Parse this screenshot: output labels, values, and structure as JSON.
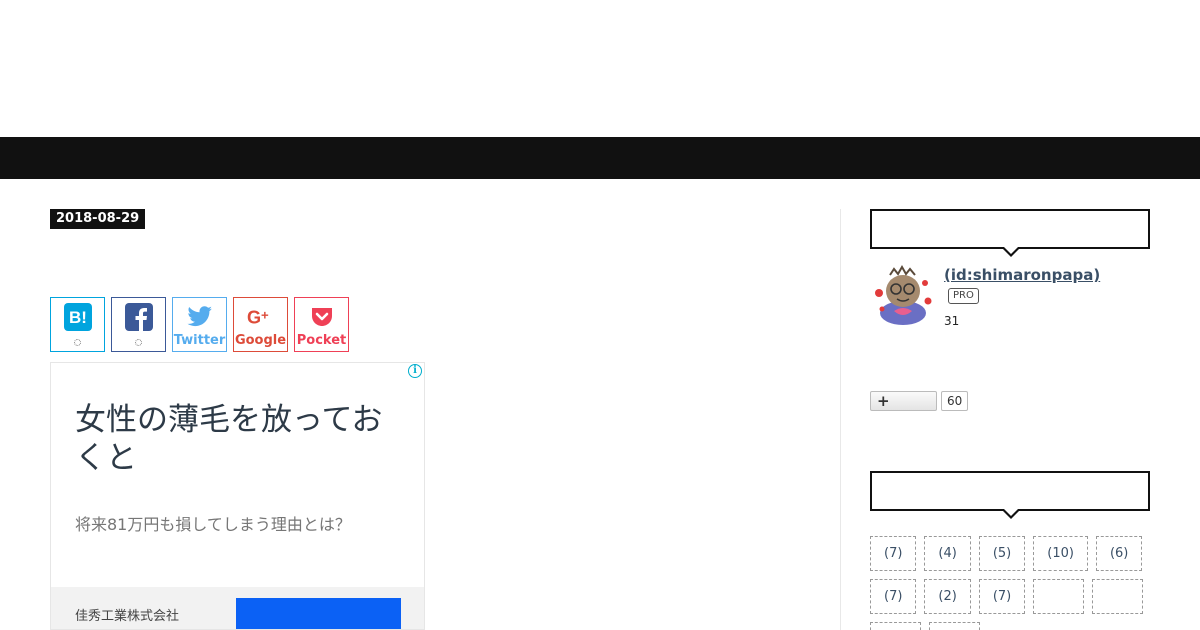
{
  "post": {
    "date": "2018-08-29"
  },
  "share_buttons": [
    {
      "name": "hatena",
      "label": "",
      "color": "#00a4de"
    },
    {
      "name": "facebook",
      "label": "",
      "color": "#3b5998"
    },
    {
      "name": "twitter",
      "label": "Twitter",
      "color": "#55acee"
    },
    {
      "name": "google",
      "label": "Google",
      "color": "#dd4b39"
    },
    {
      "name": "pocket",
      "label": "Pocket",
      "color": "#ef4056"
    }
  ],
  "ad": {
    "info_icon": "i",
    "headline": "女性の薄毛を放っておくと",
    "description": "将来81万円も損してしまう理由とは？",
    "advertiser": "佳秀工業株式会社",
    "cta_label": "",
    "cta_color": "#0b61f5"
  },
  "sidebar": {
    "profile": {
      "id": " (id:shimaronpapa)",
      "badge": "PRO",
      "count": "31"
    },
    "follow": {
      "icon": "plus-icon",
      "count": "60"
    },
    "categories": [
      "(7)",
      "(4)",
      "(5)",
      "(10)",
      "(6)",
      "(7)",
      "(2)",
      "(7)",
      "",
      "",
      "",
      ""
    ]
  },
  "colors": {
    "navbar": "#111111",
    "link": "#3a4f66"
  }
}
